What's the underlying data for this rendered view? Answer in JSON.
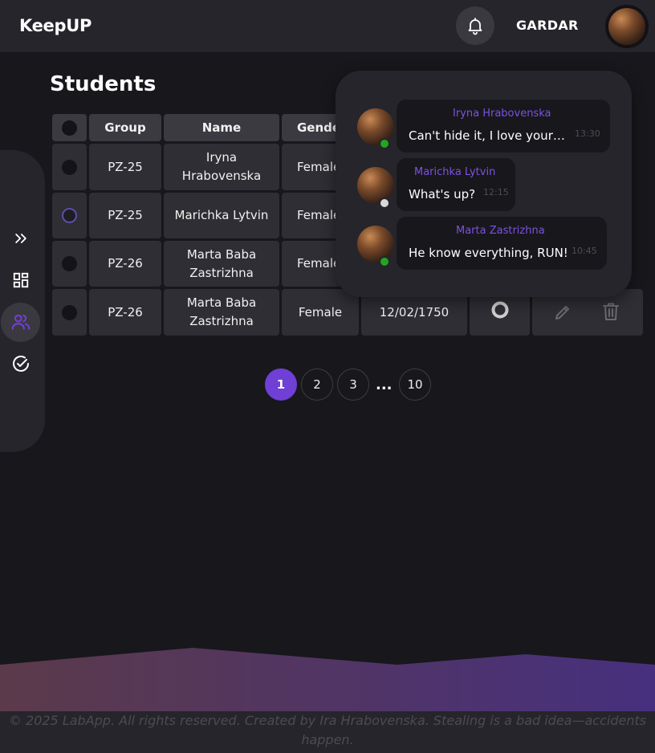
{
  "app": {
    "logo": "KeepUP",
    "username": "GARDAR"
  },
  "page": {
    "title": "Students"
  },
  "table": {
    "headers": [
      "Group",
      "Name",
      "Gender"
    ],
    "rows": [
      {
        "group": "PZ-25",
        "name": "Iryna Hrabovenska",
        "gender": "Female"
      },
      {
        "group": "PZ-25",
        "name": "Marichka Lytvin",
        "gender": "Female"
      },
      {
        "group": "PZ-26",
        "name": "Marta Baba Zastrizhna",
        "gender": "Female"
      },
      {
        "group": "PZ-26",
        "name": "Marta Baba Zastrizhna",
        "gender": "Female",
        "birthday": "12/02/1750"
      }
    ]
  },
  "pagination": {
    "pages": [
      "1",
      "2",
      "3",
      "10"
    ],
    "ellipsis": "...",
    "active": "1"
  },
  "notifications": [
    {
      "sender": "Iryna Hrabovenska",
      "text": "Can't hide it, I love your ...",
      "time": "13:30",
      "status": "online"
    },
    {
      "sender": "Marichka Lytvin",
      "text": "What's up?",
      "time": "12:15",
      "status": "offline"
    },
    {
      "sender": "Marta Zastrizhna",
      "text": "He know everything, RUN!",
      "time": "10:45",
      "status": "online"
    }
  ],
  "footer": {
    "text": "© 2025 LabApp. All rights reserved. Created by Ira Hrabovenska. Stealing is a bad idea—accidents happen."
  },
  "colors": {
    "accent": "#6f3fd6",
    "online": "#22a61f",
    "offline": "#d9d9d9"
  },
  "icons": [
    "bell-icon",
    "expand-icon",
    "dashboard-icon",
    "students-icon",
    "tasks-icon",
    "status-icon",
    "edit-icon",
    "delete-icon"
  ]
}
